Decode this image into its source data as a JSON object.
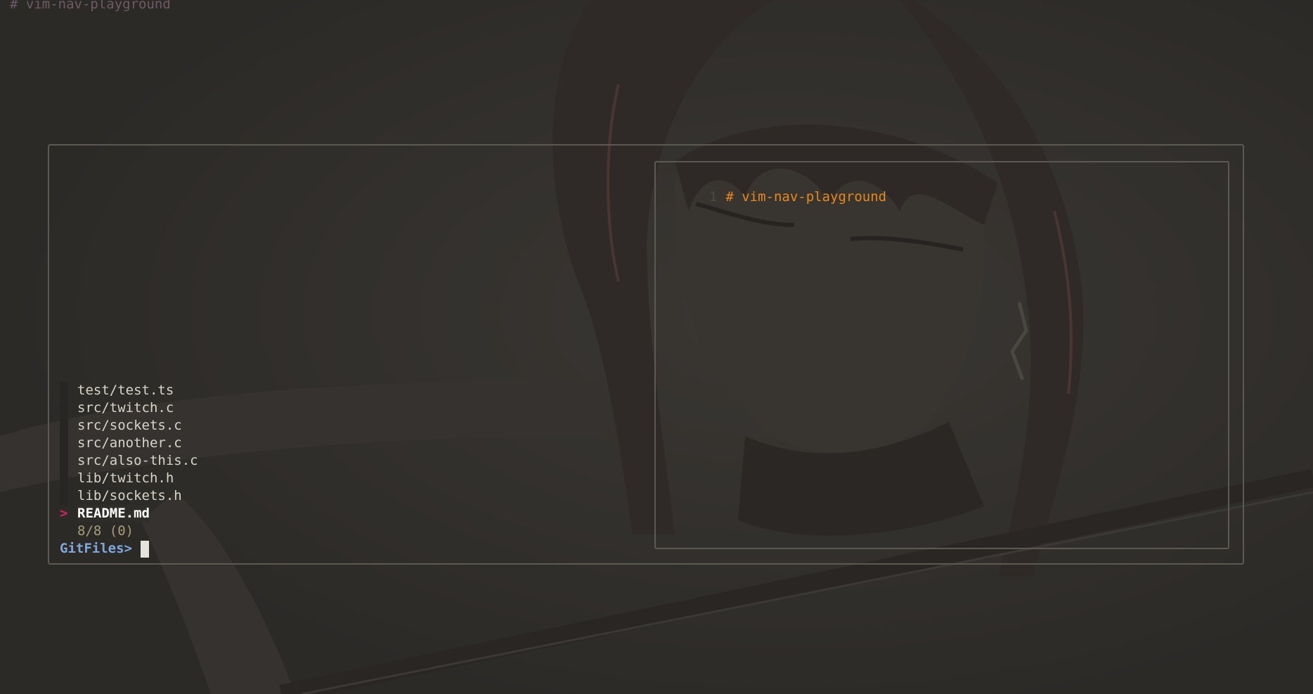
{
  "editor": {
    "top_line": "# vim-nav-playground"
  },
  "preview": {
    "line_number": "1",
    "line_text": "# vim-nav-playground"
  },
  "finder": {
    "items": [
      {
        "label": "test/test.ts",
        "selected": false
      },
      {
        "label": "src/twitch.c",
        "selected": false
      },
      {
        "label": "src/sockets.c",
        "selected": false
      },
      {
        "label": "src/another.c",
        "selected": false
      },
      {
        "label": "src/also-this.c",
        "selected": false
      },
      {
        "label": "lib/twitch.h",
        "selected": false
      },
      {
        "label": "lib/sockets.h",
        "selected": false
      },
      {
        "label": "README.md",
        "selected": true
      }
    ],
    "pointer": ">",
    "counter": "8/8 (0)",
    "prompt": "GitFiles>",
    "query": ""
  },
  "colors": {
    "background": "#302e2b",
    "preview_text": "#e8891c",
    "pointer": "#d6206a",
    "prompt": "#7fa8d8",
    "counter": "#a69d78"
  }
}
